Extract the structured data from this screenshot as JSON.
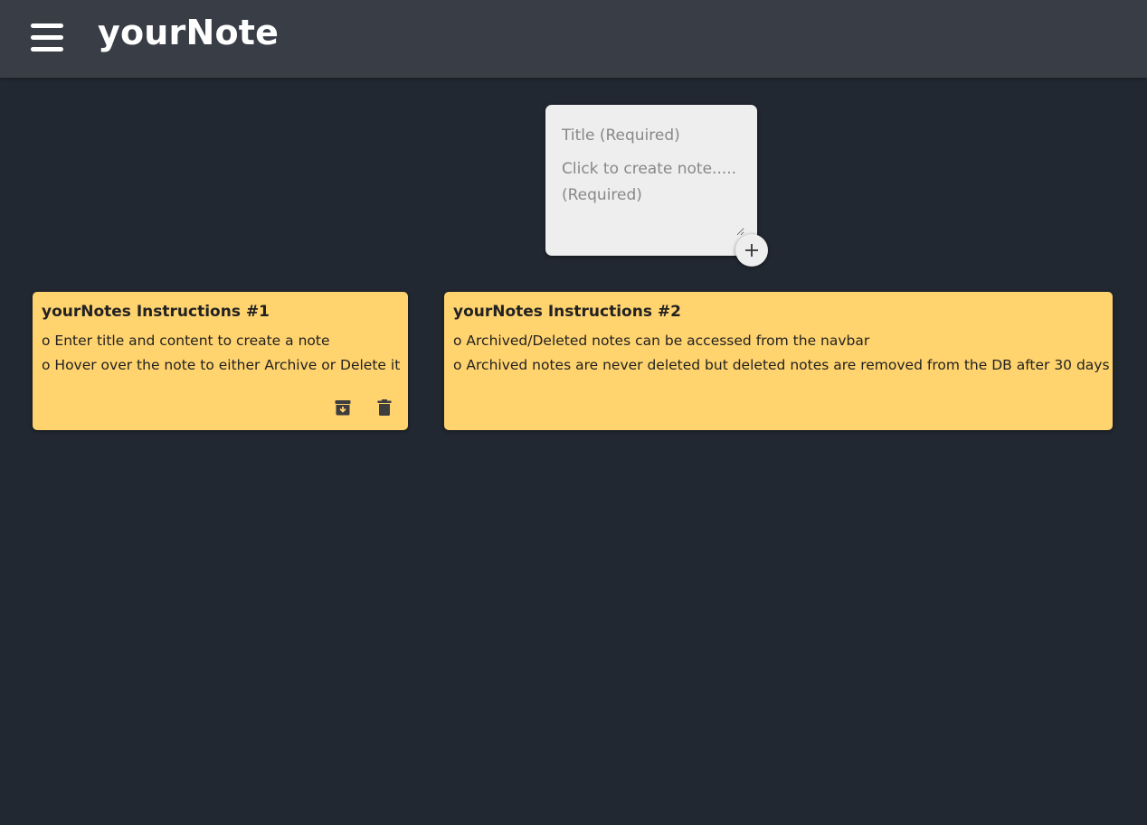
{
  "navbar": {
    "title": "yourNote",
    "menu_icon": "hamburger-menu-icon"
  },
  "create_note": {
    "title_placeholder": "Title (Required)",
    "content_placeholder": "Click to create note..... (Required)",
    "add_icon": "plus-icon"
  },
  "notes": [
    {
      "title": "yourNotes Instructions #1",
      "lines": [
        "o Enter title and content to create a note",
        "o Hover over the note to either Archive or Delete it"
      ],
      "actions": [
        "archive-icon",
        "trash-icon"
      ]
    },
    {
      "title": "yourNotes Instructions #2",
      "lines": [
        "o Archived/Deleted notes can be accessed from the navbar",
        "o Archived notes are never deleted but deleted notes are removed from the DB after 30 days"
      ],
      "actions": []
    }
  ],
  "colors": {
    "background": "#222831",
    "navbar": "#393e46",
    "note": "#ffd36e",
    "create_card": "#eeeeee"
  }
}
